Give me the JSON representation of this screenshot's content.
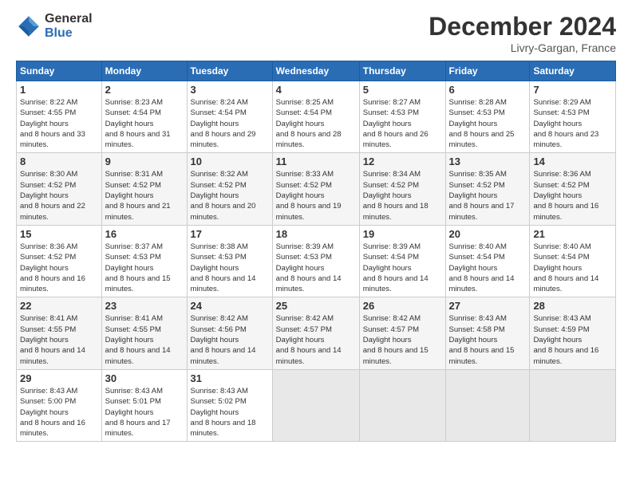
{
  "logo": {
    "general": "General",
    "blue": "Blue"
  },
  "title": "December 2024",
  "location": "Livry-Gargan, France",
  "days_header": [
    "Sunday",
    "Monday",
    "Tuesday",
    "Wednesday",
    "Thursday",
    "Friday",
    "Saturday"
  ],
  "weeks": [
    [
      {
        "day": "1",
        "sunrise": "8:22 AM",
        "sunset": "4:55 PM",
        "daylight": "8 hours and 33 minutes."
      },
      {
        "day": "2",
        "sunrise": "8:23 AM",
        "sunset": "4:54 PM",
        "daylight": "8 hours and 31 minutes."
      },
      {
        "day": "3",
        "sunrise": "8:24 AM",
        "sunset": "4:54 PM",
        "daylight": "8 hours and 29 minutes."
      },
      {
        "day": "4",
        "sunrise": "8:25 AM",
        "sunset": "4:54 PM",
        "daylight": "8 hours and 28 minutes."
      },
      {
        "day": "5",
        "sunrise": "8:27 AM",
        "sunset": "4:53 PM",
        "daylight": "8 hours and 26 minutes."
      },
      {
        "day": "6",
        "sunrise": "8:28 AM",
        "sunset": "4:53 PM",
        "daylight": "8 hours and 25 minutes."
      },
      {
        "day": "7",
        "sunrise": "8:29 AM",
        "sunset": "4:53 PM",
        "daylight": "8 hours and 23 minutes."
      }
    ],
    [
      {
        "day": "8",
        "sunrise": "8:30 AM",
        "sunset": "4:52 PM",
        "daylight": "8 hours and 22 minutes."
      },
      {
        "day": "9",
        "sunrise": "8:31 AM",
        "sunset": "4:52 PM",
        "daylight": "8 hours and 21 minutes."
      },
      {
        "day": "10",
        "sunrise": "8:32 AM",
        "sunset": "4:52 PM",
        "daylight": "8 hours and 20 minutes."
      },
      {
        "day": "11",
        "sunrise": "8:33 AM",
        "sunset": "4:52 PM",
        "daylight": "8 hours and 19 minutes."
      },
      {
        "day": "12",
        "sunrise": "8:34 AM",
        "sunset": "4:52 PM",
        "daylight": "8 hours and 18 minutes."
      },
      {
        "day": "13",
        "sunrise": "8:35 AM",
        "sunset": "4:52 PM",
        "daylight": "8 hours and 17 minutes."
      },
      {
        "day": "14",
        "sunrise": "8:36 AM",
        "sunset": "4:52 PM",
        "daylight": "8 hours and 16 minutes."
      }
    ],
    [
      {
        "day": "15",
        "sunrise": "8:36 AM",
        "sunset": "4:52 PM",
        "daylight": "8 hours and 16 minutes."
      },
      {
        "day": "16",
        "sunrise": "8:37 AM",
        "sunset": "4:53 PM",
        "daylight": "8 hours and 15 minutes."
      },
      {
        "day": "17",
        "sunrise": "8:38 AM",
        "sunset": "4:53 PM",
        "daylight": "8 hours and 14 minutes."
      },
      {
        "day": "18",
        "sunrise": "8:39 AM",
        "sunset": "4:53 PM",
        "daylight": "8 hours and 14 minutes."
      },
      {
        "day": "19",
        "sunrise": "8:39 AM",
        "sunset": "4:54 PM",
        "daylight": "8 hours and 14 minutes."
      },
      {
        "day": "20",
        "sunrise": "8:40 AM",
        "sunset": "4:54 PM",
        "daylight": "8 hours and 14 minutes."
      },
      {
        "day": "21",
        "sunrise": "8:40 AM",
        "sunset": "4:54 PM",
        "daylight": "8 hours and 14 minutes."
      }
    ],
    [
      {
        "day": "22",
        "sunrise": "8:41 AM",
        "sunset": "4:55 PM",
        "daylight": "8 hours and 14 minutes."
      },
      {
        "day": "23",
        "sunrise": "8:41 AM",
        "sunset": "4:55 PM",
        "daylight": "8 hours and 14 minutes."
      },
      {
        "day": "24",
        "sunrise": "8:42 AM",
        "sunset": "4:56 PM",
        "daylight": "8 hours and 14 minutes."
      },
      {
        "day": "25",
        "sunrise": "8:42 AM",
        "sunset": "4:57 PM",
        "daylight": "8 hours and 14 minutes."
      },
      {
        "day": "26",
        "sunrise": "8:42 AM",
        "sunset": "4:57 PM",
        "daylight": "8 hours and 15 minutes."
      },
      {
        "day": "27",
        "sunrise": "8:43 AM",
        "sunset": "4:58 PM",
        "daylight": "8 hours and 15 minutes."
      },
      {
        "day": "28",
        "sunrise": "8:43 AM",
        "sunset": "4:59 PM",
        "daylight": "8 hours and 16 minutes."
      }
    ],
    [
      {
        "day": "29",
        "sunrise": "8:43 AM",
        "sunset": "5:00 PM",
        "daylight": "8 hours and 16 minutes."
      },
      {
        "day": "30",
        "sunrise": "8:43 AM",
        "sunset": "5:01 PM",
        "daylight": "8 hours and 17 minutes."
      },
      {
        "day": "31",
        "sunrise": "8:43 AM",
        "sunset": "5:02 PM",
        "daylight": "8 hours and 18 minutes."
      },
      null,
      null,
      null,
      null
    ]
  ]
}
